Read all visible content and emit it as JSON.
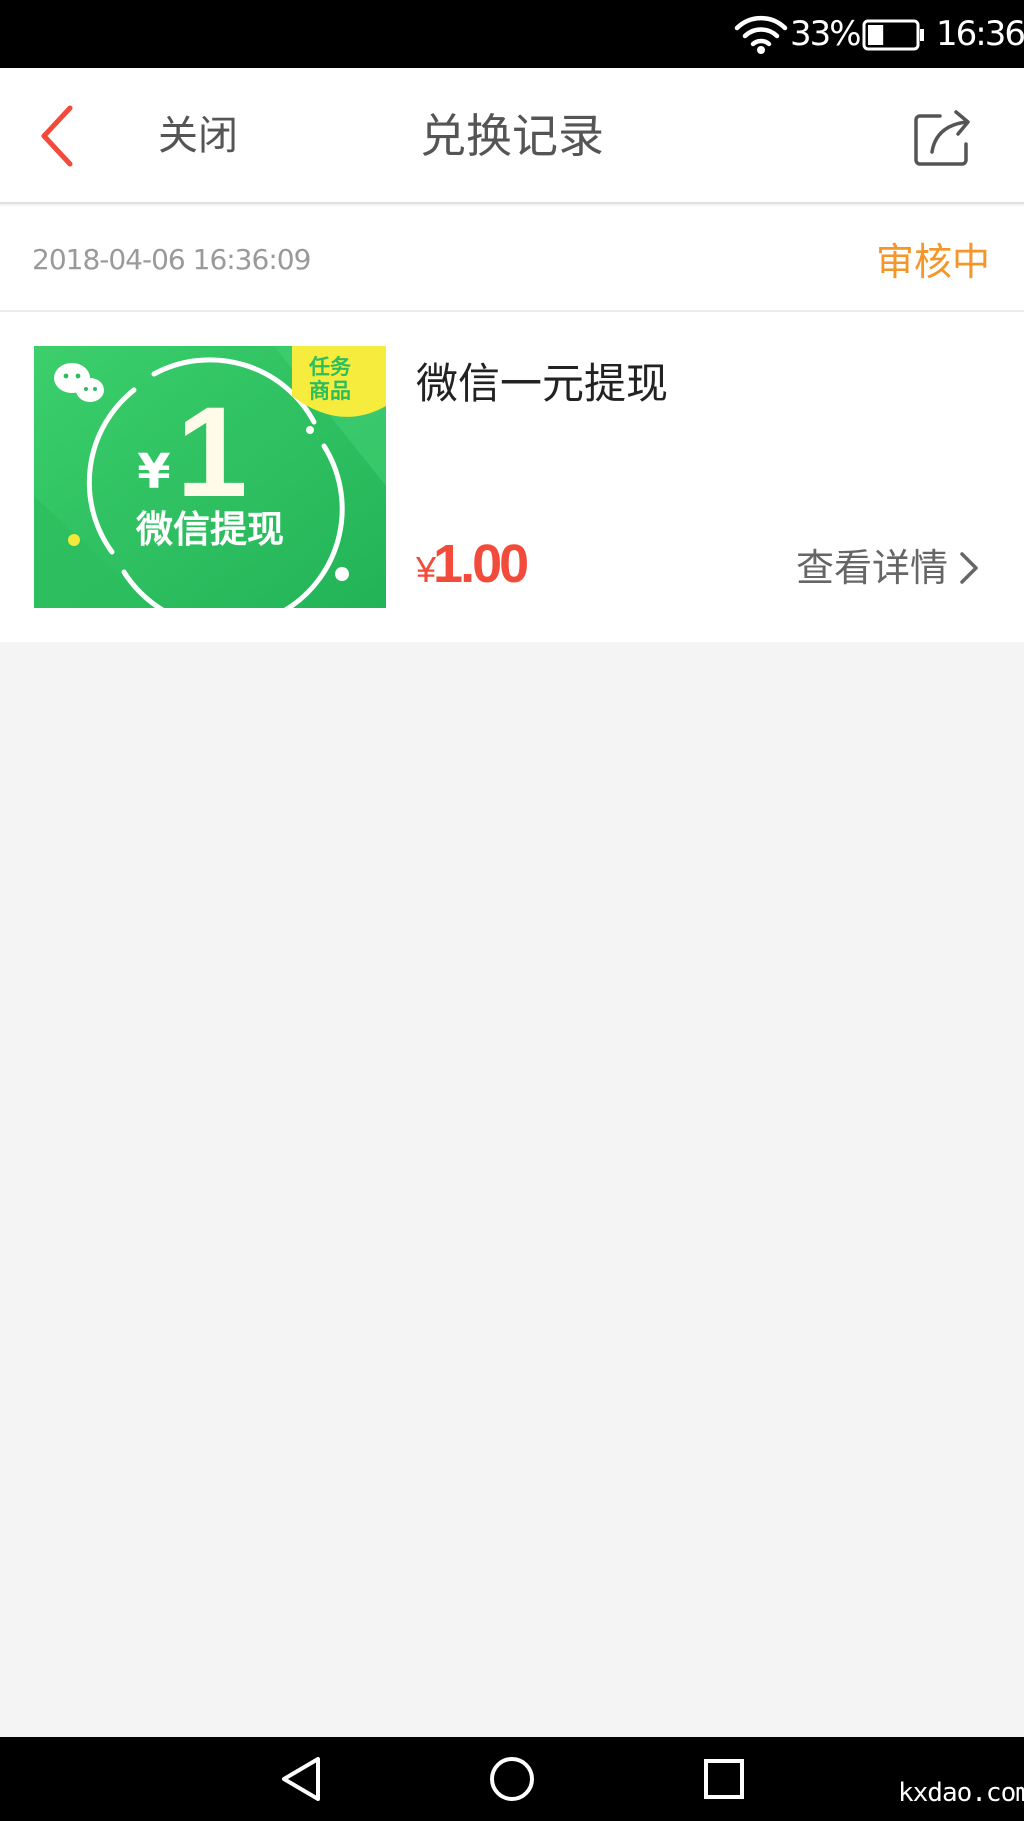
{
  "status_bar": {
    "battery_percent": "33%",
    "battery_level": 0.33,
    "time": "16:36",
    "wifi_icon": "wifi-icon",
    "battery_icon": "battery-icon"
  },
  "header": {
    "back_icon": "chevron-left-icon",
    "close_label": "关闭",
    "title": "兑换记录",
    "share_icon": "share-icon"
  },
  "record": {
    "date": "2018-04-06 16:36:09",
    "status": "审核中",
    "product": {
      "thumbnail": {
        "currency_symbol": "¥",
        "amount": "1",
        "caption": "微信提现",
        "tag_line1": "任务",
        "tag_line2": "商品",
        "wechat_icon": "wechat-icon"
      },
      "name": "微信一元提现",
      "price_currency": "¥",
      "price_amount": "1.00",
      "details_label": "查看详情",
      "details_icon": "chevron-right-icon"
    }
  },
  "nav_bar": {
    "back_icon": "triangle-back-icon",
    "home_icon": "circle-home-icon",
    "recents_icon": "square-recents-icon"
  },
  "watermark": "kxdao.com",
  "colors": {
    "accent_red": "#f24b3c",
    "status_orange": "#f4962a",
    "thumb_green": "#2ec364"
  }
}
